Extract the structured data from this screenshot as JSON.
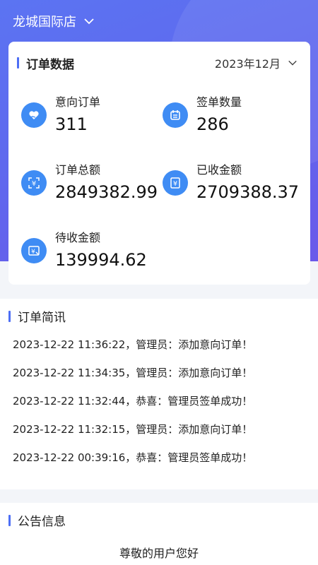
{
  "header": {
    "store_name": "龙城国际店"
  },
  "order_data": {
    "title": "订单数据",
    "month": "2023年12月",
    "stats": [
      {
        "label": "意向订单",
        "value": "311",
        "icon": "heart-hand-icon"
      },
      {
        "label": "签单数量",
        "value": "286",
        "icon": "calendar-icon"
      },
      {
        "label": "订单总额",
        "value": "2849382.99",
        "icon": "yen-scan-icon"
      },
      {
        "label": "已收金额",
        "value": "2709388.37",
        "icon": "yen-doc-icon"
      },
      {
        "label": "待收金额",
        "value": "139994.62",
        "icon": "yen-card-icon"
      }
    ]
  },
  "news": {
    "title": "订单简讯",
    "items": [
      "2023-12-22 11:36:22，管理员：添加意向订单！",
      "2023-12-22 11:34:35，管理员：添加意向订单！",
      "2023-12-22 11:32:44，恭喜：管理员签单成功！",
      "2023-12-22 11:32:15，管理员：添加意向订单！",
      "2023-12-22 00:39:16，恭喜：管理员签单成功！"
    ]
  },
  "notice": {
    "title": "公告信息",
    "greeting": "尊敬的用户您好"
  },
  "colors": {
    "accent": "#4d6ef5",
    "icon_bg": "#3f8cf4",
    "hero": "#5f68ee"
  }
}
